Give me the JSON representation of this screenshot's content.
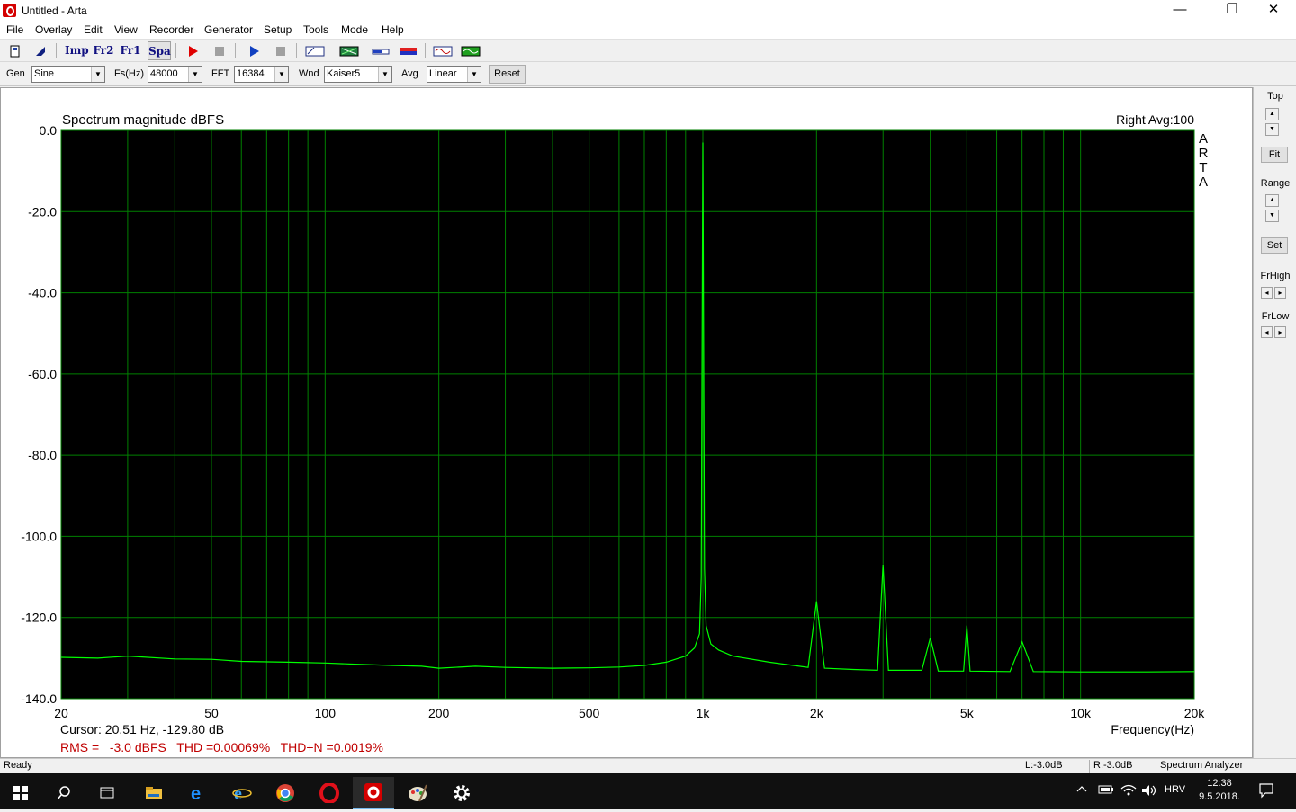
{
  "window": {
    "title": "Untitled - Arta",
    "minimize": "—",
    "restore": "❐",
    "close": "✕"
  },
  "menu": [
    "File",
    "Overlay",
    "Edit",
    "View",
    "Recorder",
    "Generator",
    "Setup",
    "Tools",
    "Mode",
    "Help"
  ],
  "toolbar": {
    "imp": "Imp",
    "fr2": "Fr2",
    "fr1": "Fr1",
    "spa": "Spa"
  },
  "controls": {
    "gen_label": "Gen",
    "gen_value": "Sine",
    "fs_label": "Fs(Hz)",
    "fs_value": "48000",
    "fft_label": "FFT",
    "fft_value": "16384",
    "wnd_label": "Wnd",
    "wnd_value": "Kaiser5",
    "avg_label": "Avg",
    "avg_value": "Linear",
    "reset_label": "Reset"
  },
  "plot": {
    "title": "Spectrum magnitude dBFS",
    "channel_info": "Right  Avg:100",
    "logo_letters": [
      "A",
      "R",
      "T",
      "A"
    ],
    "cursor": "Cursor: 20.51 Hz, -129.80 dB",
    "measurement": "RMS =   -3.0 dBFS   THD =0.00069%   THD+N =0.0019%"
  },
  "right_panel": {
    "top": "Top",
    "fit": "Fit",
    "range": "Range",
    "set": "Set",
    "frhigh": "FrHigh",
    "frlow": "FrLow"
  },
  "status": {
    "ready": "Ready",
    "left_level": "L:-3.0dB",
    "right_level": "R:-3.0dB",
    "mode": "Spectrum Analyzer"
  },
  "taskbar": {
    "lang": "HRV",
    "time": "12:38",
    "date": "9.5.2018."
  },
  "colors": {
    "plot_bg": "#000000",
    "grid": "#008000",
    "trace": "#00ff00",
    "measurement_text": "#c00000"
  },
  "chart_data": {
    "type": "line",
    "title": "Spectrum magnitude dBFS",
    "xlabel": "Frequency(Hz)",
    "ylabel": "",
    "x_scale": "log",
    "xlim": [
      20,
      20000
    ],
    "ylim": [
      -140,
      0
    ],
    "x_ticks": [
      20,
      50,
      100,
      200,
      500,
      1000,
      2000,
      5000,
      10000,
      20000
    ],
    "x_tick_labels": [
      "20",
      "50",
      "100",
      "200",
      "500",
      "1k",
      "2k",
      "5k",
      "10k",
      "20k"
    ],
    "y_ticks": [
      0,
      -20,
      -40,
      -60,
      -80,
      -100,
      -120,
      -140
    ],
    "y_tick_labels": [
      "0.0",
      "-20.0",
      "-40.0",
      "-60.0",
      "-80.0",
      "-100.0",
      "-120.0",
      "-140.0"
    ],
    "grid": true,
    "series": [
      {
        "x": [
          20,
          25,
          30,
          40,
          50,
          60,
          80,
          100,
          120,
          150,
          180,
          200,
          250,
          300,
          400,
          500,
          600,
          700,
          800,
          900,
          950,
          980,
          990,
          1000,
          1010,
          1020,
          1050,
          1100,
          1200,
          1500,
          1900,
          2000,
          2100,
          2500,
          2900,
          3000,
          3100,
          3800,
          4000,
          4200,
          4900,
          5000,
          5100,
          6500,
          7000,
          7500,
          10000,
          15000,
          20000
        ],
        "y": [
          -129.8,
          -130,
          -129.5,
          -130.2,
          -130.3,
          -130.8,
          -131,
          -131.2,
          -131.5,
          -131.8,
          -132,
          -132.5,
          -132,
          -132.3,
          -132.5,
          -132.4,
          -132.2,
          -131.8,
          -131,
          -129.5,
          -127.5,
          -124,
          -110,
          -3,
          -108,
          -122,
          -126.5,
          -128,
          -129.5,
          -131,
          -132.3,
          -116,
          -132.5,
          -132.8,
          -133,
          -107,
          -133,
          -133,
          -125,
          -133.2,
          -133.2,
          -122,
          -133.2,
          -133.3,
          -126,
          -133.3,
          -133.4,
          -133.4,
          -133.3
        ]
      }
    ]
  }
}
